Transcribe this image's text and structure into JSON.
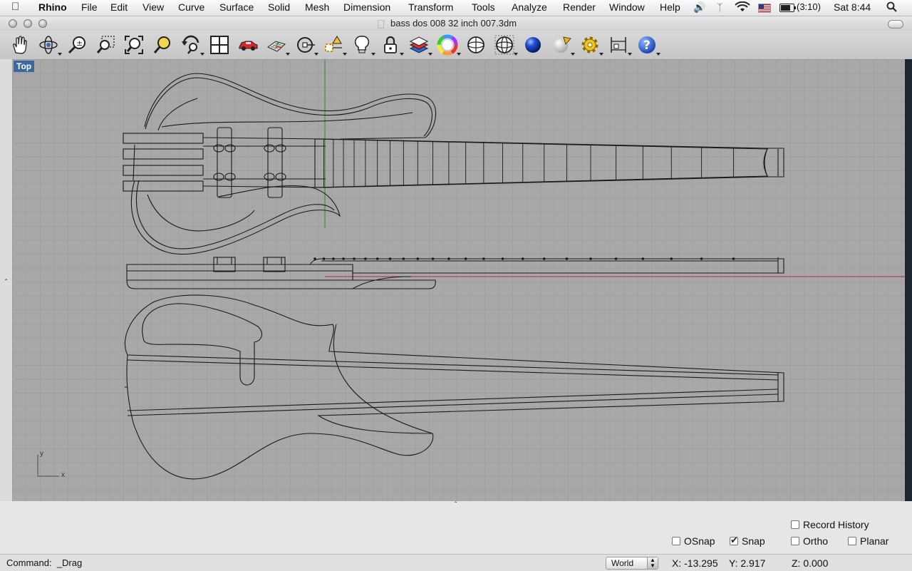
{
  "menubar": {
    "app_name": "Rhino",
    "items": [
      "File",
      "Edit",
      "View",
      "Curve",
      "Surface",
      "Solid",
      "Mesh",
      "Dimension",
      "Transform",
      "Tools",
      "Analyze",
      "Render",
      "Window",
      "Help"
    ],
    "battery": "(3:10)",
    "clock": "Sat 8:44"
  },
  "window": {
    "title": "bass dos 008 32 inch 007.3dm"
  },
  "toolbar": {
    "icons": [
      "pan-icon",
      "rotate-view-icon",
      "zoom-dynamic-icon",
      "zoom-window-icon",
      "zoom-extents-icon",
      "zoom-selected-icon",
      "undo-view-icon",
      "four-viewports-icon",
      "car-perspective-icon",
      "construction-plane-icon",
      "osnap-icon",
      "gumball-icon",
      "light-bulb-icon",
      "lock-icon",
      "layers-icon",
      "color-wheel-icon",
      "wireframe-sphere-icon",
      "shaded-sphere-icon",
      "rendered-sphere-icon",
      "render-preview-icon",
      "material-cone-icon",
      "options-gear-icon",
      "dimension-icon",
      "help-icon"
    ]
  },
  "viewport": {
    "label": "Top",
    "axis_y": "y",
    "axis_x": "x"
  },
  "panel": {
    "record_history": "Record History",
    "osnap": "OSnap",
    "snap": "Snap",
    "ortho": "Ortho",
    "planar": "Planar",
    "snap_checked": true,
    "osnap_checked": false,
    "ortho_checked": false,
    "planar_checked": false,
    "record_history_checked": false
  },
  "statusbar": {
    "command_label": "Command:",
    "command_value": "_Drag",
    "cplane": "World",
    "x": "X: -13.295",
    "y": "Y: 2.917",
    "z": "Z: 0.000"
  }
}
